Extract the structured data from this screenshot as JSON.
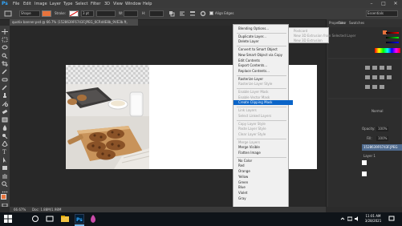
{
  "menubar": {
    "app_logo": "Ps",
    "items": [
      "File",
      "Edit",
      "Image",
      "Layer",
      "Type",
      "Select",
      "Filter",
      "3D",
      "View",
      "Window",
      "Help"
    ],
    "window_controls": [
      "–",
      "□",
      "✕"
    ]
  },
  "options_bar": {
    "mode": "Shape",
    "stroke_label": "Stroke:",
    "stroke_width": "3 pt",
    "w_label": "W:",
    "h_label": "H:",
    "align_edges": "Align Edges",
    "workspace": "Essentials"
  },
  "document": {
    "tab_title": "quotix banner.psd @ 66.7% (1528639F6743F.JPEG_6CRd4E8b_9VE3b.ft, RGB/8) *"
  },
  "context_menu": {
    "items": [
      {
        "label": "Blending Options...",
        "state": "normal"
      },
      {
        "sep": true
      },
      {
        "label": "Duplicate Layer...",
        "state": "normal"
      },
      {
        "label": "Delete Layer",
        "state": "normal"
      },
      {
        "sep": true
      },
      {
        "label": "Convert to Smart Object",
        "state": "normal"
      },
      {
        "label": "New Smart Object via Copy",
        "state": "normal"
      },
      {
        "label": "Edit Contents",
        "state": "normal"
      },
      {
        "label": "Export Contents...",
        "state": "normal"
      },
      {
        "label": "Replace Contents...",
        "state": "normal"
      },
      {
        "sep": true
      },
      {
        "label": "Rasterize Layer",
        "state": "normal"
      },
      {
        "label": "Rasterize Layer Style",
        "state": "disabled"
      },
      {
        "sep": true
      },
      {
        "label": "Enable Layer Mask",
        "state": "disabled"
      },
      {
        "label": "Enable Vector Mask",
        "state": "disabled"
      },
      {
        "label": "Create Clipping Mask",
        "state": "highlighted"
      },
      {
        "sep": true
      },
      {
        "label": "Link Layers",
        "state": "disabled"
      },
      {
        "label": "Select Linked Layers",
        "state": "disabled"
      },
      {
        "sep": true
      },
      {
        "label": "Copy Layer Style",
        "state": "disabled"
      },
      {
        "label": "Paste Layer Style",
        "state": "disabled"
      },
      {
        "label": "Clear Layer Style",
        "state": "disabled"
      },
      {
        "sep": true
      },
      {
        "label": "Merge Layers",
        "state": "disabled"
      },
      {
        "label": "Merge Visible",
        "state": "normal"
      },
      {
        "label": "Flatten Image",
        "state": "normal"
      },
      {
        "sep": true
      },
      {
        "label": "No Color",
        "state": "normal"
      },
      {
        "label": "Red",
        "state": "normal"
      },
      {
        "label": "Orange",
        "state": "normal"
      },
      {
        "label": "Yellow",
        "state": "normal"
      },
      {
        "label": "Green",
        "state": "normal"
      },
      {
        "label": "Blue",
        "state": "normal"
      },
      {
        "label": "Violet",
        "state": "normal"
      },
      {
        "label": "Gray",
        "state": "normal"
      }
    ]
  },
  "submenu": {
    "items": [
      "Postcard",
      "New 3D Extrusion from Selected Layer",
      "New 3D Extrusion"
    ]
  },
  "right_panel": {
    "tabs": [
      "Properties",
      "Color",
      "Swatches"
    ],
    "opacity_label": "Opacity:",
    "opacity_value": "100%",
    "fill_label": "Fill:",
    "fill_value": "100%",
    "mode_value": "Normal",
    "layer_name": "Layer 1",
    "layer_name_2": "1528639F6743F.JPEG"
  },
  "status_bar": {
    "zoom": "66.67%",
    "doc_size": "Doc: 1.88M/1.98M"
  },
  "taskbar": {
    "time": "11:01 AM",
    "date": "3/28/2021"
  },
  "colors": {
    "accent": "#0a64c8",
    "ps_blue": "#31a8ff"
  }
}
